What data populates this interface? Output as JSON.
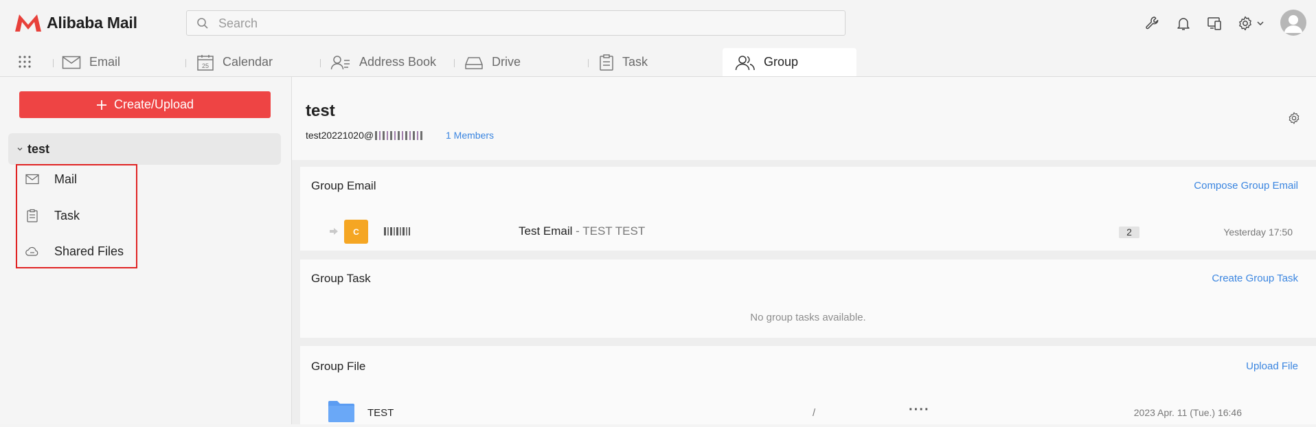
{
  "app": {
    "title": "Alibaba Mail",
    "accent_color": "#ee4444",
    "link_color": "#3a85e0"
  },
  "search": {
    "placeholder": "Search"
  },
  "header_icons": [
    "wrench-icon",
    "bell-icon",
    "devices-icon",
    "gear-icon",
    "chevron-down-icon",
    "avatar"
  ],
  "nav": {
    "apps_icon": "grid-icon",
    "items": [
      {
        "label": "Email",
        "icon": "mail-icon"
      },
      {
        "label": "Calendar",
        "icon": "calendar-icon",
        "icon_text": "25"
      },
      {
        "label": "Address Book",
        "icon": "contacts-icon"
      },
      {
        "label": "Drive",
        "icon": "drive-icon"
      },
      {
        "label": "Task",
        "icon": "clipboard-icon"
      },
      {
        "label": "Group",
        "icon": "group-icon",
        "active": true
      }
    ]
  },
  "sidebar": {
    "create_label": "Create/Upload",
    "group": {
      "name": "test"
    },
    "items": [
      {
        "label": "Mail",
        "icon": "mail-icon"
      },
      {
        "label": "Task",
        "icon": "clipboard-icon"
      },
      {
        "label": "Shared Files",
        "icon": "cloud-icon"
      }
    ]
  },
  "group": {
    "title": "test",
    "email_prefix": "test20221020@",
    "members": "1 Members"
  },
  "sections": {
    "email": {
      "title": "Group Email",
      "action": "Compose Group Email",
      "rows": [
        {
          "avatar_letter": "C",
          "avatar_color": "#f5a623",
          "subject": "Test Email",
          "preview": " - TEST TEST",
          "count": "2",
          "time": "Yesterday 17:50"
        }
      ]
    },
    "task": {
      "title": "Group Task",
      "action": "Create Group Task",
      "empty": "No group tasks available."
    },
    "file": {
      "title": "Group File",
      "action": "Upload File",
      "rows": [
        {
          "name": "TEST",
          "path": "/",
          "more": "····",
          "time": "2023 Apr. 11 (Tue.) 16:46",
          "folder_color": "#5b9cf2"
        }
      ]
    }
  }
}
